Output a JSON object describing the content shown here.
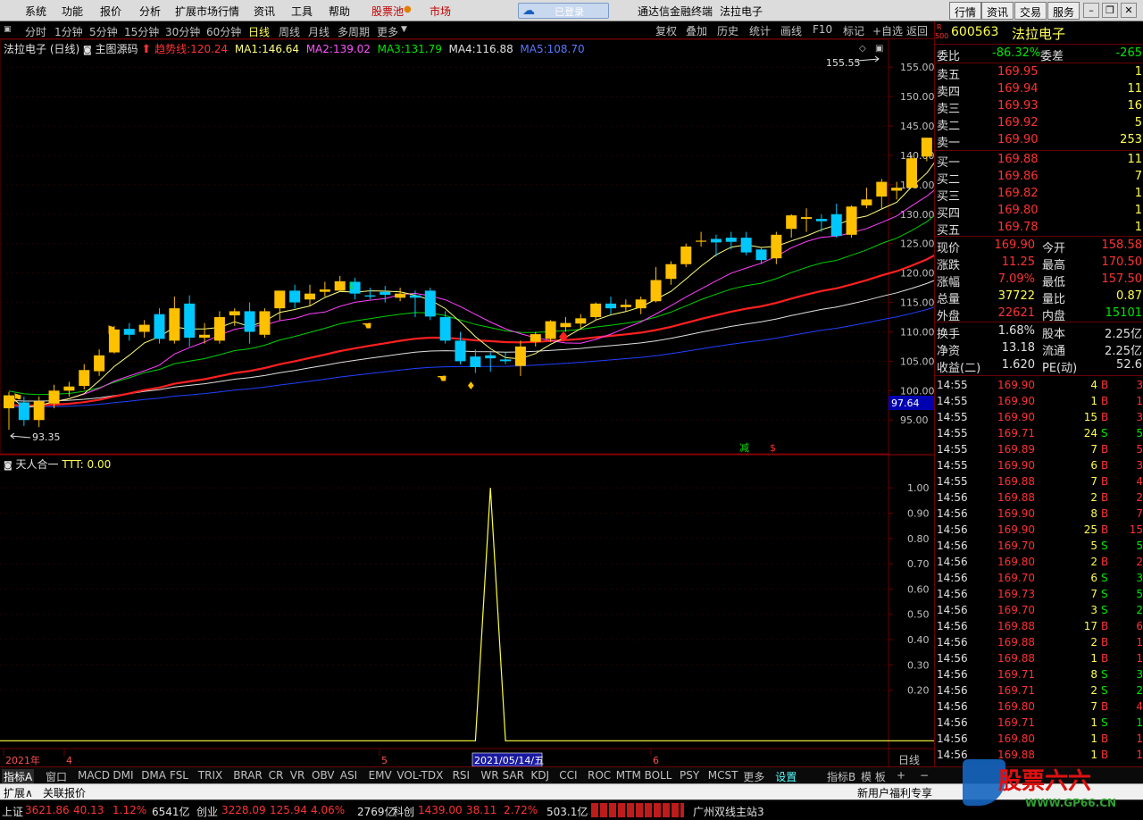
{
  "menu": {
    "items": [
      "系统",
      "功能",
      "报价",
      "分析",
      "扩展市场行情",
      "资讯",
      "工具",
      "帮助"
    ],
    "stock_pool": "股票池",
    "market": "市场",
    "login": "已登录",
    "title": "通达信金融终端",
    "stock_title": "法拉电子",
    "right_buttons": [
      "行情",
      "资讯",
      "交易",
      "服务"
    ]
  },
  "periods": {
    "items": [
      "分时",
      "1分钟",
      "5分钟",
      "15分钟",
      "30分钟",
      "60分钟",
      "日线",
      "周线",
      "月线",
      "多周期",
      "更多"
    ],
    "active": "日线",
    "tools": [
      "复权",
      "叠加",
      "历史",
      "统计",
      "画线",
      "F10",
      "标记",
      "+自选",
      "返回"
    ]
  },
  "main_legend": {
    "name": "法拉电子 (日线)",
    "source": "主图源码",
    "trend_label": "趋势线:",
    "trend_value": "120.24",
    "ma": [
      {
        "label": "MA1:",
        "value": "146.64"
      },
      {
        "label": "MA2:",
        "value": "139.02"
      },
      {
        "label": "MA3:",
        "value": "131.79"
      },
      {
        "label": "MA4:",
        "value": "116.88"
      },
      {
        "label": "MA5:",
        "value": "108.70"
      }
    ]
  },
  "sub_legend": {
    "name": "天人合一",
    "label": "TTT:",
    "value": "0.00"
  },
  "chart_data": [
    {
      "type": "candlestick",
      "title": "法拉电子 (日线)",
      "y_ticks": [
        95,
        100,
        105,
        110,
        115,
        120,
        125,
        130,
        135,
        140,
        145,
        150,
        155
      ],
      "ylim": [
        92,
        157
      ],
      "annotations": {
        "high": "155.55",
        "low": "93.35",
        "price_tag": "97.64",
        "markers": [
          "减",
          "$"
        ]
      },
      "candles": [
        [
          97,
          99.8,
          93.35,
          99.2
        ],
        [
          98,
          99,
          94,
          95
        ],
        [
          95,
          99,
          93.8,
          98.2
        ],
        [
          97.8,
          101,
          97,
          100
        ],
        [
          100,
          101.5,
          99,
          100.7
        ],
        [
          100.8,
          104.5,
          100.2,
          103.5
        ],
        [
          103.3,
          107,
          102.5,
          106
        ],
        [
          106.5,
          111,
          106.3,
          110.4
        ],
        [
          110.5,
          111.5,
          108.5,
          109.5
        ],
        [
          110,
          112,
          109,
          111.2
        ],
        [
          113,
          114,
          108,
          108.8
        ],
        [
          108.5,
          116,
          108,
          114
        ],
        [
          114.8,
          116.2,
          107.5,
          109
        ],
        [
          109,
          111.5,
          108,
          109.5
        ],
        [
          108.5,
          113.5,
          108,
          112.5
        ],
        [
          112.8,
          114,
          111,
          113.5
        ],
        [
          113.5,
          115,
          108,
          110
        ],
        [
          109.5,
          114,
          109,
          113.5
        ],
        [
          114,
          117,
          112,
          117
        ],
        [
          117,
          118,
          114,
          115
        ],
        [
          115.5,
          118,
          114.5,
          116.5
        ],
        [
          116.8,
          118.5,
          116,
          117.2
        ],
        [
          117,
          119.5,
          117,
          118.6
        ],
        [
          118.5,
          119.2,
          115.5,
          116.5
        ],
        [
          116.2,
          117.5,
          115.5,
          116
        ],
        [
          116.8,
          117.8,
          115,
          116.3
        ],
        [
          115.8,
          117.5,
          115.2,
          116.5
        ],
        [
          116.2,
          117,
          112.5,
          115.8
        ],
        [
          117,
          117.5,
          112,
          112.6
        ],
        [
          112.5,
          113.5,
          108,
          108.5
        ],
        [
          108.5,
          110,
          104.5,
          105
        ],
        [
          105.8,
          107,
          103,
          104
        ],
        [
          106,
          106.5,
          103.2,
          105.5
        ],
        [
          105.3,
          106.5,
          104.5,
          105
        ],
        [
          104.2,
          108.5,
          102.5,
          107.5
        ],
        [
          108.3,
          110,
          107.5,
          109.6
        ],
        [
          108.8,
          112,
          108.3,
          111.8
        ],
        [
          110.8,
          112.5,
          110,
          111.5
        ],
        [
          111.4,
          113,
          110.5,
          112.3
        ],
        [
          112.5,
          115,
          112,
          114.8
        ],
        [
          114.8,
          116,
          113,
          114
        ],
        [
          114.2,
          115.5,
          113.5,
          114.6
        ],
        [
          114,
          116,
          113,
          115.5
        ],
        [
          115.2,
          121,
          115,
          118.8
        ],
        [
          119,
          122,
          118,
          121.5
        ],
        [
          121.5,
          125,
          121,
          124.5
        ],
        [
          125.5,
          127,
          124.5,
          125.5
        ],
        [
          125.8,
          126.5,
          122.8,
          125.2
        ],
        [
          126,
          127,
          124,
          125.3
        ],
        [
          126,
          127,
          123,
          123.5
        ],
        [
          124,
          124.5,
          121.5,
          122.2
        ],
        [
          122.5,
          127,
          121.5,
          126.5
        ],
        [
          127.5,
          130,
          126,
          129.8
        ],
        [
          129.2,
          131,
          127,
          129.5
        ],
        [
          129.2,
          130,
          127,
          128.8
        ],
        [
          130,
          131.8,
          126,
          126.3
        ],
        [
          126.5,
          131.5,
          126,
          131.3
        ],
        [
          131.5,
          134.5,
          131,
          132.5
        ],
        [
          133,
          136,
          131,
          135.5
        ],
        [
          134,
          135.5,
          132.5,
          134.5
        ],
        [
          134.5,
          140,
          134.5,
          139.5
        ],
        [
          139.8,
          143,
          139,
          143
        ],
        [
          144,
          150.5,
          142,
          150
        ],
        [
          149.5,
          151,
          146,
          148.5
        ],
        [
          148.5,
          155.55,
          147.5,
          151.5
        ]
      ]
    },
    {
      "type": "line",
      "title": "天人合一",
      "y_ticks": [
        0.2,
        0.3,
        0.4,
        0.5,
        0.6,
        0.7,
        0.8,
        0.9,
        1.0
      ],
      "ylim": [
        -0.02,
        1.05
      ],
      "series": [
        {
          "name": "TTT",
          "values": [
            0,
            0,
            0,
            0,
            0,
            0,
            0,
            0,
            0,
            0,
            0,
            0,
            0,
            0,
            0,
            0,
            0,
            0,
            0,
            0,
            0,
            0,
            0,
            0,
            0,
            0,
            0,
            0,
            0,
            0,
            0,
            0,
            1,
            0,
            0,
            0,
            0,
            0,
            0,
            0,
            0,
            0,
            0,
            0,
            0,
            0,
            0,
            0,
            0,
            0,
            0,
            0,
            0,
            0,
            0,
            0,
            0,
            0,
            0,
            0,
            0,
            0,
            0,
            0,
            0
          ]
        }
      ],
      "x_labels": [
        "2021年",
        "4",
        "5",
        "6"
      ],
      "x_cursor": "2021/05/14/五"
    }
  ],
  "side": {
    "badge_top": "R",
    "badge_bot": "500",
    "code": "600563",
    "name": "法拉电子",
    "weibi_label": "委比",
    "weibi": "-86.32%",
    "weicha_label": "委差",
    "weicha": "-265",
    "asks": [
      {
        "label": "卖五",
        "price": "169.95",
        "vol": "1"
      },
      {
        "label": "卖四",
        "price": "169.94",
        "vol": "11"
      },
      {
        "label": "卖三",
        "price": "169.93",
        "vol": "16"
      },
      {
        "label": "卖二",
        "price": "169.92",
        "vol": "5"
      },
      {
        "label": "卖一",
        "price": "169.90",
        "vol": "253"
      }
    ],
    "bids": [
      {
        "label": "买一",
        "price": "169.88",
        "vol": "11"
      },
      {
        "label": "买二",
        "price": "169.86",
        "vol": "7"
      },
      {
        "label": "买三",
        "price": "169.82",
        "vol": "1"
      },
      {
        "label": "买四",
        "price": "169.80",
        "vol": "1"
      },
      {
        "label": "买五",
        "price": "169.78",
        "vol": "1"
      }
    ],
    "stats": [
      {
        "l1": "现价",
        "v1": "169.90",
        "c1": "red",
        "l2": "今开",
        "v2": "158.58",
        "c2": "red"
      },
      {
        "l1": "涨跌",
        "v1": "11.25",
        "c1": "red",
        "l2": "最高",
        "v2": "170.50",
        "c2": "red"
      },
      {
        "l1": "涨幅",
        "v1": "7.09%",
        "c1": "red",
        "l2": "最低",
        "v2": "157.50",
        "c2": "red"
      },
      {
        "l1": "总量",
        "v1": "37722",
        "c1": "yellow",
        "l2": "量比",
        "v2": "0.87",
        "c2": "yellow"
      },
      {
        "l1": "外盘",
        "v1": "22621",
        "c1": "red",
        "l2": "内盘",
        "v2": "15101",
        "c2": "green"
      }
    ],
    "stats2": [
      {
        "l1": "换手",
        "v1": "1.68%",
        "l2": "股本",
        "v2": "2.25亿"
      },
      {
        "l1": "净资",
        "v1": "13.18",
        "l2": "流通",
        "v2": "2.25亿"
      },
      {
        "l1": "收益(二)",
        "v1": "1.620",
        "l2": "PE(动)",
        "v2": "52.6"
      }
    ],
    "ticks": [
      [
        "14:55",
        "169.90",
        "4",
        "B",
        "3"
      ],
      [
        "14:55",
        "169.90",
        "1",
        "B",
        "1"
      ],
      [
        "14:55",
        "169.90",
        "15",
        "B",
        "3"
      ],
      [
        "14:55",
        "169.71",
        "24",
        "S",
        "5"
      ],
      [
        "14:55",
        "169.89",
        "7",
        "B",
        "5"
      ],
      [
        "14:55",
        "169.90",
        "6",
        "B",
        "3"
      ],
      [
        "14:55",
        "169.88",
        "7",
        "B",
        "4"
      ],
      [
        "14:56",
        "169.88",
        "2",
        "B",
        "2"
      ],
      [
        "14:56",
        "169.90",
        "8",
        "B",
        "7"
      ],
      [
        "14:56",
        "169.90",
        "25",
        "B",
        "15"
      ],
      [
        "14:56",
        "169.70",
        "5",
        "S",
        "5"
      ],
      [
        "14:56",
        "169.80",
        "2",
        "B",
        "2"
      ],
      [
        "14:56",
        "169.70",
        "6",
        "S",
        "3"
      ],
      [
        "14:56",
        "169.73",
        "7",
        "S",
        "5"
      ],
      [
        "14:56",
        "169.70",
        "3",
        "S",
        "2"
      ],
      [
        "14:56",
        "169.88",
        "17",
        "B",
        "6"
      ],
      [
        "14:56",
        "169.88",
        "2",
        "B",
        "1"
      ],
      [
        "14:56",
        "169.88",
        "1",
        "B",
        "1"
      ],
      [
        "14:56",
        "169.71",
        "8",
        "S",
        "3"
      ],
      [
        "14:56",
        "169.71",
        "2",
        "S",
        "2"
      ],
      [
        "14:56",
        "169.80",
        "7",
        "B",
        "4"
      ],
      [
        "14:56",
        "169.71",
        "1",
        "S",
        "1"
      ],
      [
        "14:56",
        "169.80",
        "1",
        "B",
        "1"
      ],
      [
        "14:56",
        "169.88",
        "1",
        "B",
        "1"
      ]
    ]
  },
  "tabs": {
    "items": [
      "指标A",
      "窗口",
      "MACD",
      "DMI",
      "DMA",
      "FSL",
      "TRIX",
      "BRAR",
      "CR",
      "VR",
      "OBV",
      "ASI",
      "EMV",
      "VOL-TDX",
      "RSI",
      "WR",
      "SAR",
      "KDJ",
      "CCI",
      "ROC",
      "MTM",
      "BOLL",
      "PSY",
      "MCST",
      "更多",
      "设置"
    ],
    "right": [
      "指标B",
      "模 板",
      "+",
      "−"
    ],
    "period_label": "日线"
  },
  "ext": {
    "items": [
      "扩展∧",
      "关联报价"
    ],
    "right": "新用户福利专享"
  },
  "status": {
    "indices": [
      {
        "name": "上证",
        "val": "3621.86",
        "chg": "40.13",
        "pct": "1.12%",
        "amt": "6541亿"
      },
      {
        "name": "创业",
        "val": "3228.09",
        "chg": "125.94",
        "pct": "4.06%",
        "amt": "2769亿"
      },
      {
        "name": "科创",
        "val": "1439.00",
        "chg": "38.11",
        "pct": "2.72%",
        "amt": "503.1亿"
      }
    ],
    "server": "广州双线主站3"
  },
  "watermark": {
    "text": "股票六六",
    "url": "WWW.GP66.CN"
  },
  "colors": {
    "up": "#ffc000",
    "down": "#00c8ff",
    "ma1": "#ffff80",
    "ma2": "#ff40ff",
    "ma3": "#00d000",
    "ma4": "#ff2020",
    "ma5": "#e0e0e0",
    "ma6": "#2040ff",
    "grid": "#6a0000"
  }
}
